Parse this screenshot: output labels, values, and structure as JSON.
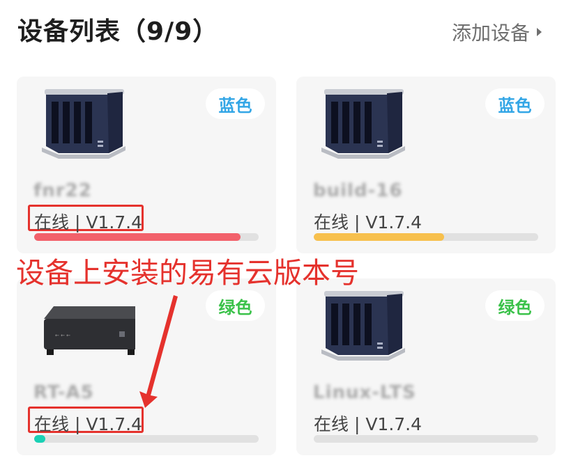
{
  "header": {
    "title": "设备列表（9/9）",
    "add_label": "添加设备"
  },
  "devices": [
    {
      "name": "fnr22",
      "color_tag": "蓝色",
      "tag_color": "#33a6e6",
      "status": "在线 | V1.7.4",
      "usage_fraction": 0.92,
      "bar_color": "#f2616b",
      "icon": "nas-server-icon"
    },
    {
      "name": "build-16",
      "color_tag": "蓝色",
      "tag_color": "#33a6e6",
      "status": "在线 | V1.7.4",
      "usage_fraction": 0.58,
      "bar_color": "#f7c04d",
      "icon": "nas-server-icon"
    },
    {
      "name": "RT-A5",
      "color_tag": "绿色",
      "tag_color": "#3bc24a",
      "status": "在线 | V1.7.4",
      "usage_fraction": 0.05,
      "bar_color": "#19d1b5",
      "icon": "router-box-icon"
    },
    {
      "name": "Linux-LTS",
      "color_tag": "绿色",
      "tag_color": "#3bc24a",
      "status": "在线 | V1.7.4",
      "usage_fraction": 0.0,
      "bar_color": "#19d1b5",
      "icon": "nas-server-icon"
    }
  ],
  "annotation": {
    "text": "设备上安装的易有云版本号",
    "color": "#e5322d"
  }
}
